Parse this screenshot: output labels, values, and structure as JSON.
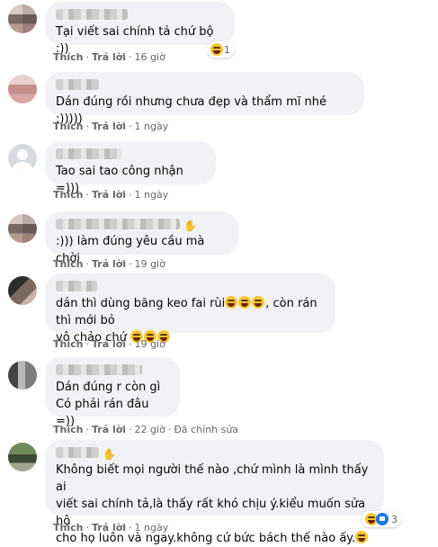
{
  "actions": {
    "like": "Thích",
    "reply": "Trả lời",
    "edited": "Đã chỉnh sửa"
  },
  "comments": [
    {
      "text": "Tại viết sai chính tả chứ bộ :))",
      "time": "16 giờ",
      "reaction_count": "1"
    },
    {
      "text": "Dán đúng rồi nhưng chưa đẹp và thẩm mĩ nhé :)))))",
      "time": "1 ngày"
    },
    {
      "text": "Tao sai tao công nhận =)))",
      "time": "1 ngày"
    },
    {
      "text": ":))) làm đúng yêu cầu mà chời",
      "time": "19 giờ"
    },
    {
      "text_line1": "dán thì dùng băng keo fai rùi",
      "text_line1_end": ", còn rán thì mới bỏ",
      "text_line2": "vô chảo chứ",
      "time": "19 giờ"
    },
    {
      "text_line1": "Dán đúng r còn gì",
      "text_line2": "Có phải rán đâu =))",
      "time": "22 giờ"
    },
    {
      "text_line1": "Không biết mọi người thế nào ,chứ mình là mình thấy ai",
      "text_line2": "viết sai chính tả,là thấy rất khó chịu ý.kiểu muốn sửa hộ",
      "text_line3": "cho họ luôn và ngay.không cứ bức bách thế nào ấy.",
      "time": "1 ngày",
      "reaction_count": "3"
    }
  ]
}
